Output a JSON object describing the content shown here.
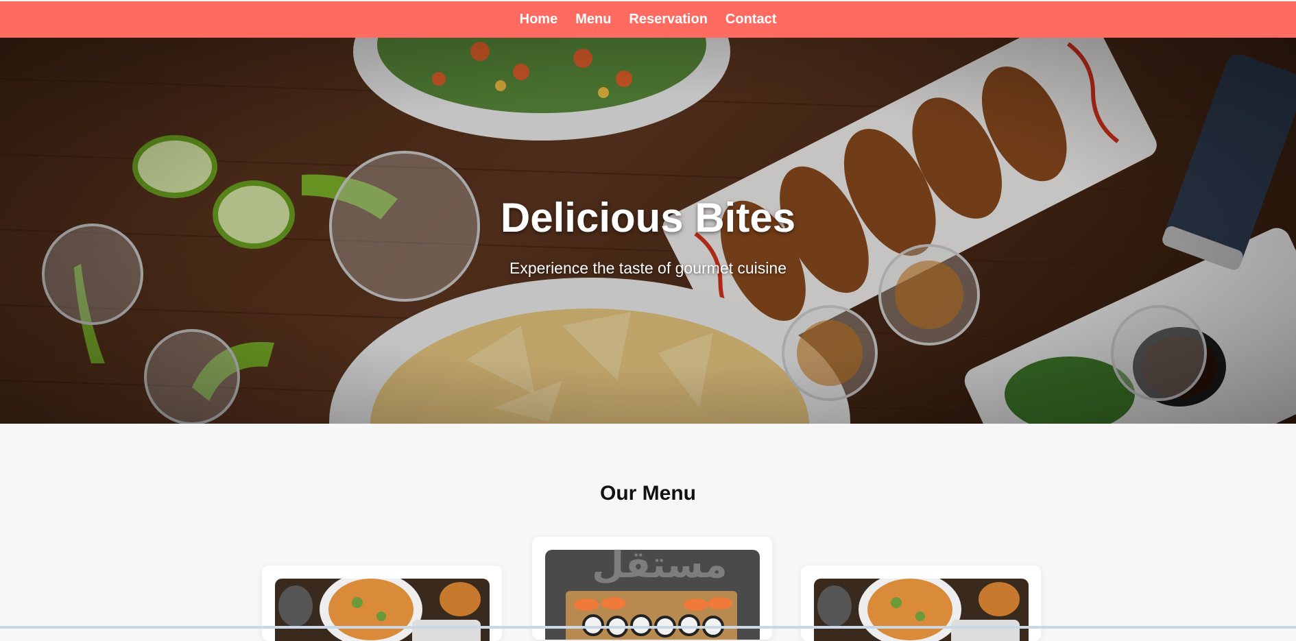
{
  "nav": {
    "items": [
      {
        "label": "Home"
      },
      {
        "label": "Menu"
      },
      {
        "label": "Reservation"
      },
      {
        "label": "Contact"
      }
    ],
    "background_color": "#ff6b61"
  },
  "hero": {
    "title": "Delicious Bites",
    "subtitle": "Experience the taste of gourmet cuisine"
  },
  "menu_section": {
    "title": "Our Menu",
    "cards": [
      {
        "image": "food-platter-image"
      },
      {
        "image": "sushi-platter-image"
      },
      {
        "image": "food-platter-image"
      }
    ]
  },
  "watermark": {
    "text": "مستقل"
  }
}
